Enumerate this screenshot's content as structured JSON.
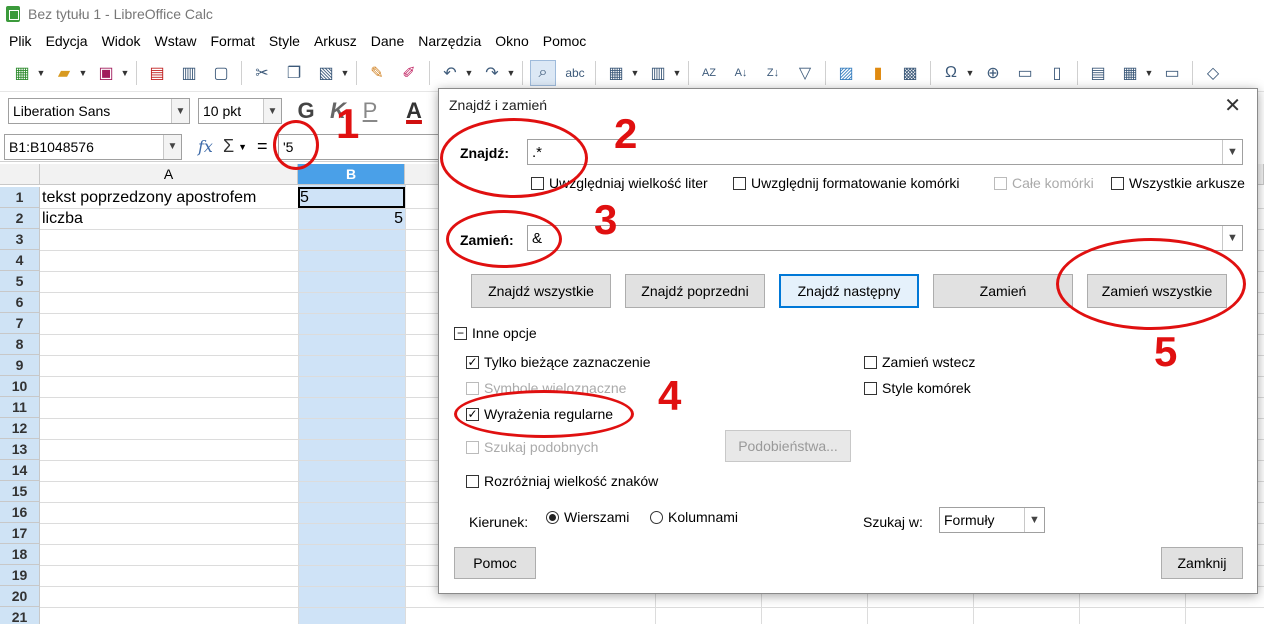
{
  "window": {
    "title": "Bez tytułu 1 - LibreOffice Calc"
  },
  "menu": [
    "Plik",
    "Edycja",
    "Widok",
    "Wstaw",
    "Format",
    "Style",
    "Arkusz",
    "Dane",
    "Narzędzia",
    "Okno",
    "Pomoc"
  ],
  "format_toolbar": {
    "font_name": "Liberation Sans",
    "font_size": "10 pkt",
    "bold": "G",
    "italic": "K",
    "underline": "P",
    "font_color": "A"
  },
  "formula_bar": {
    "name_box": "B1:B1048576",
    "fx": "fx",
    "sum": "Σ",
    "equals": "=",
    "content": "'5"
  },
  "grid": {
    "columns": [
      "A",
      "B"
    ],
    "rows": [
      "1",
      "2",
      "3",
      "4",
      "5",
      "6",
      "7",
      "8",
      "9",
      "10",
      "11",
      "12",
      "13",
      "14",
      "15",
      "16",
      "17",
      "18",
      "19",
      "20",
      "21"
    ],
    "cells": {
      "A1": "tekst poprzedzony apostrofem",
      "B1": "5",
      "A2": "liczba",
      "B2": "5"
    }
  },
  "dialog": {
    "title": "Znajdź i zamień",
    "find_label": "Znajdź:",
    "find_value": ".*",
    "replace_label": "Zamień:",
    "replace_value": "&",
    "options_row": {
      "match_case": "Uwzględniaj wielkość liter",
      "match_format": "Uwzględnij formatowanie komórki",
      "entire_cells": "Całe komórki",
      "all_sheets": "Wszystkie arkusze"
    },
    "buttons": {
      "find_all": "Znajdź wszystkie",
      "find_prev": "Znajdź poprzedni",
      "find_next": "Znajdź następny",
      "replace": "Zamień",
      "replace_all": "Zamień wszystkie"
    },
    "other_options": "Inne opcje",
    "current_selection": "Tylko bieżące zaznaczenie",
    "wildcards": "Symbole wieloznaczne",
    "regex": "Wyrażenia regularne",
    "similarity": "Szukaj podobnych",
    "similarity_btn": "Podobieństwa...",
    "case_sensitive": "Rozróżniaj wielkość znaków",
    "replace_backwards": "Zamień wstecz",
    "cell_styles": "Style komórek",
    "direction_label": "Kierunek:",
    "direction_rows": "Wierszami",
    "direction_cols": "Kolumnami",
    "search_in_label": "Szukaj w:",
    "search_in_value": "Formuły",
    "help": "Pomoc",
    "close": "Zamknij"
  },
  "annotations": [
    "1",
    "2",
    "3",
    "4",
    "5"
  ]
}
